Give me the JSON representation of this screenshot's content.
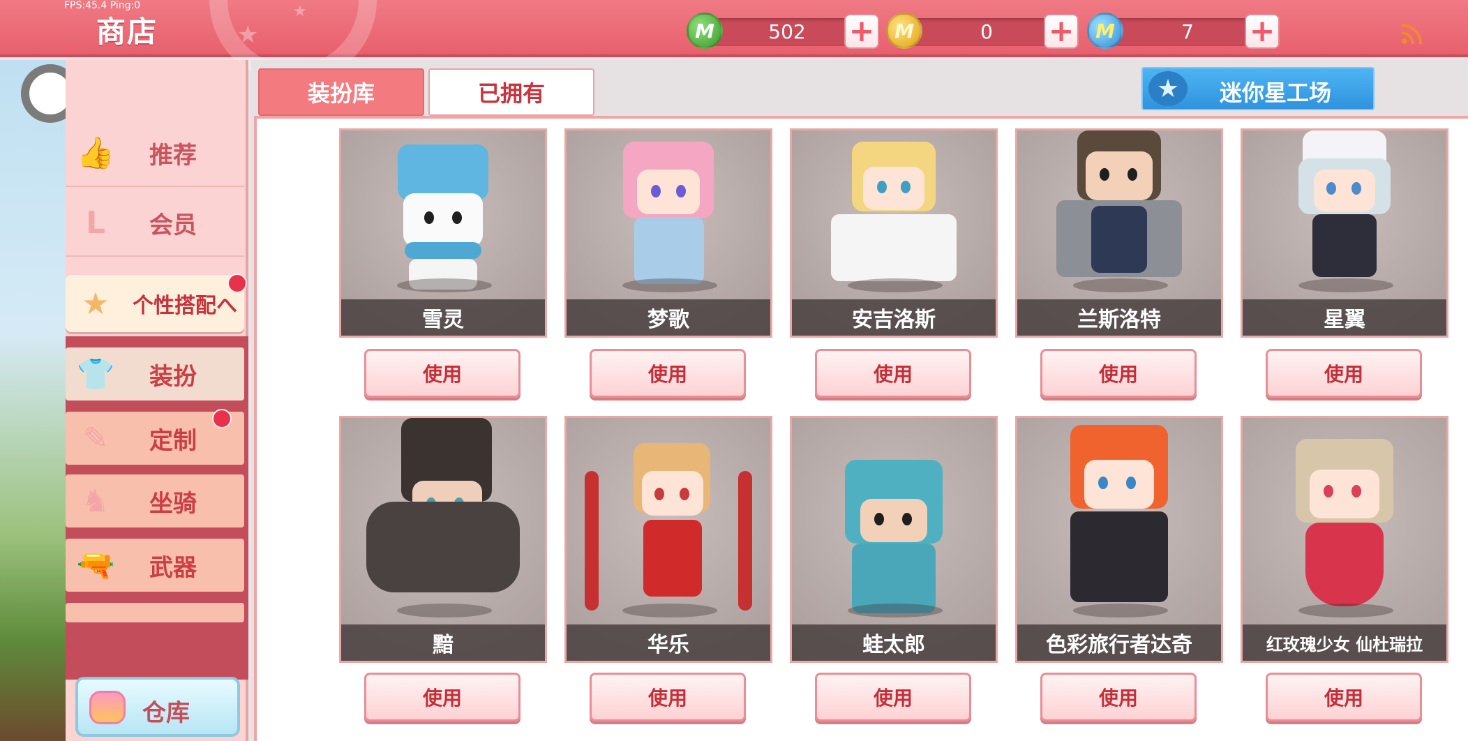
{
  "fps_text": "FPS:45.4  Ping:0",
  "title": "商店",
  "currencies": [
    {
      "icon": "green-mini-coin-icon",
      "value": "502"
    },
    {
      "icon": "gold-m-coin-icon",
      "value": "0"
    },
    {
      "icon": "blue-mini-bean-icon",
      "value": "7"
    }
  ],
  "sidebar": {
    "main_items": [
      {
        "label": "推荐",
        "icon": "thumbs-up-icon"
      },
      {
        "label": "会员",
        "icon": "member-icon"
      }
    ],
    "expanded": {
      "label": "个性搭配へ",
      "icon": "star-badge-icon"
    },
    "sub_items": [
      {
        "label": "装扮",
        "icon": "shirt-icon"
      },
      {
        "label": "定制",
        "icon": "pencil-icon"
      },
      {
        "label": "坐骑",
        "icon": "mount-icon"
      },
      {
        "label": "武器",
        "icon": "gun-icon"
      }
    ],
    "storage_label": "仓库"
  },
  "tabs": [
    {
      "label": "装扮库"
    },
    {
      "label": "已拥有"
    }
  ],
  "workshop_label": "迷你星工场",
  "use_label": "使用",
  "characters": [
    {
      "name": "雪灵"
    },
    {
      "name": "梦歌"
    },
    {
      "name": "安吉洛斯"
    },
    {
      "name": "兰斯洛特"
    },
    {
      "name": "星翼"
    },
    {
      "name": "黯"
    },
    {
      "name": "华乐"
    },
    {
      "name": "蛙太郎"
    },
    {
      "name": "色彩旅行者达奇"
    },
    {
      "name": "红玫瑰少女 仙杜瑞拉"
    }
  ],
  "colors": {
    "topbar": "#e8606d",
    "accent_red": "#c8343d",
    "button_pink": "#fdd2d4",
    "workshop_blue": "#2f93dd"
  }
}
